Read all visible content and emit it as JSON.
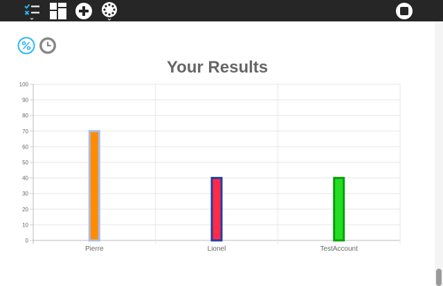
{
  "toolbar": {
    "icons": [
      "checklist-icon",
      "dashboard-grid-icon",
      "add-icon",
      "settings-dial-icon",
      "stop-icon"
    ]
  },
  "modes": {
    "icons": [
      "percent-icon",
      "clock-icon"
    ],
    "active_color": "#29b6f6",
    "inactive_color": "#888888"
  },
  "chart_data": {
    "type": "bar",
    "title": "Your Results",
    "categories": [
      "Pierre",
      "Lionel",
      "TestAccount"
    ],
    "values": [
      70,
      40,
      40
    ],
    "fill_colors": [
      "#ff8c00",
      "#ff2b47",
      "#22dd22"
    ],
    "border_colors": [
      "#a9bce6",
      "#1f3fa6",
      "#0a9f0a"
    ],
    "ylim": [
      0,
      100
    ],
    "yticks": [
      0,
      10,
      20,
      30,
      40,
      50,
      60,
      70,
      80,
      90,
      100
    ],
    "grid": true
  }
}
